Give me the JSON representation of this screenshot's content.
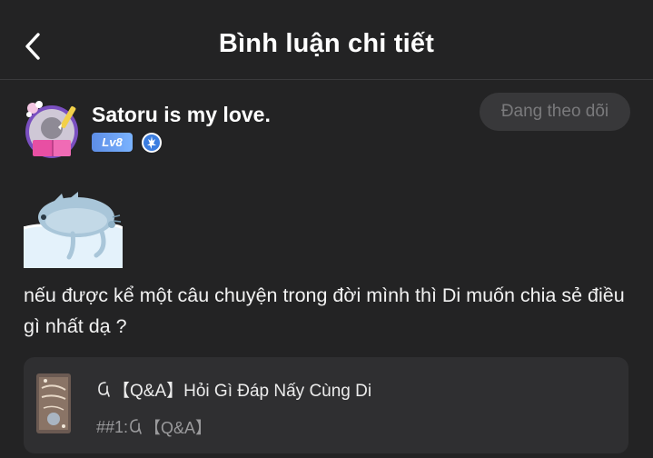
{
  "header": {
    "title": "Bình luận chi tiết"
  },
  "author": {
    "name": "Satoru is my love.",
    "level": "Lv8",
    "follow_label": "Đang theo dõi"
  },
  "comment": {
    "text": "nếu được kể một câu chuyện trong đời mình thì Di muốn chia sẻ điều gì nhất dạ ?"
  },
  "reference": {
    "title": "【Q&A】Hỏi Gì Đáp Nấy Cùng Di",
    "chapter_prefix": "##1: ",
    "chapter_title": "【Q&A】"
  },
  "colors": {
    "background": "#232324",
    "card": "#2f2f31",
    "level_badge": "#6a9df2",
    "follow_button": "#38383a"
  }
}
